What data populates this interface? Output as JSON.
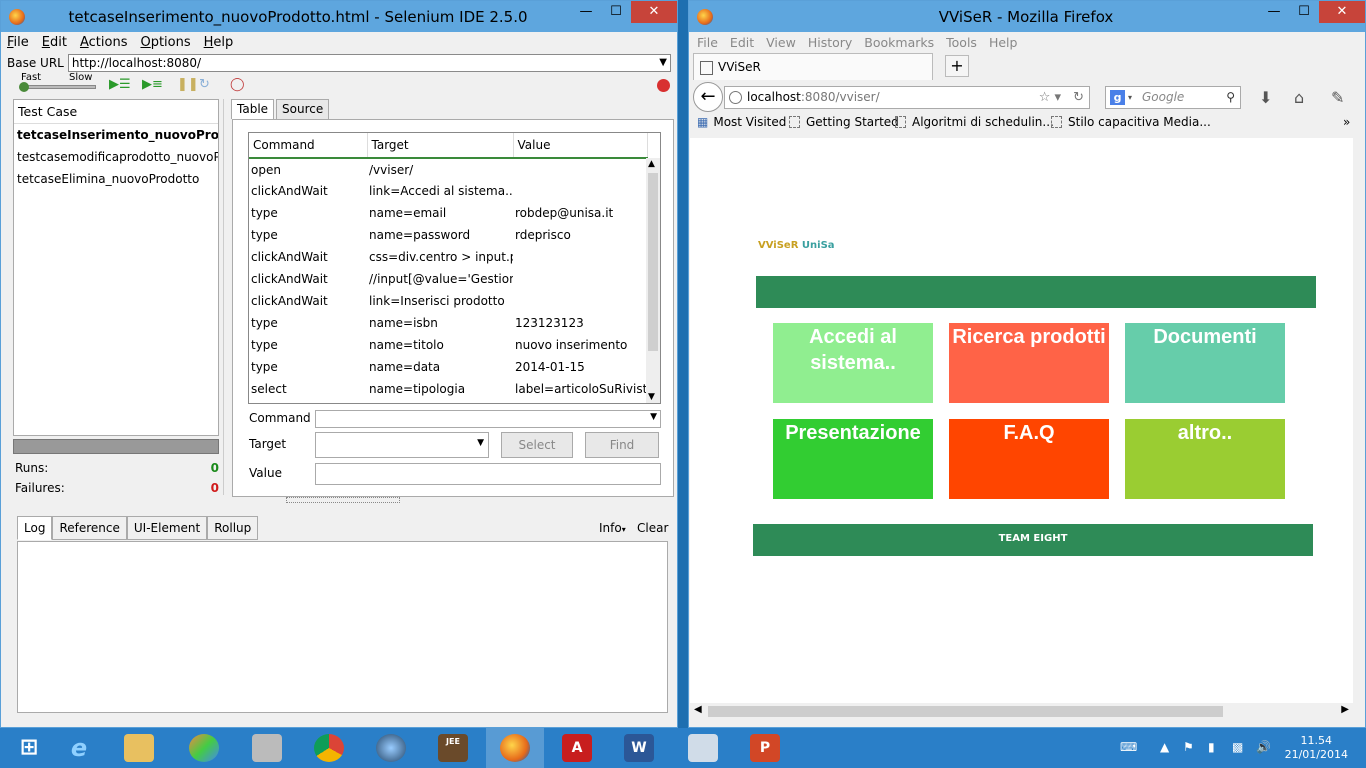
{
  "selenium": {
    "title": "tetcaseInserimento_nuovoProdotto.html - Selenium IDE 2.5.0",
    "menu": [
      "File",
      "Edit",
      "Actions",
      "Options",
      "Help"
    ],
    "base_url_label": "Base URL",
    "base_url_value": "http://localhost:8080/",
    "speed_fast": "Fast",
    "speed_slow": "Slow",
    "test_case_header": "Test Case",
    "test_cases": [
      "tetcaseInserimento_nuovoProdo...",
      "testcasemodificaprodotto_nuovoPr...",
      "tetcaseElimina_nuovoProdotto"
    ],
    "runs_label": "Runs:",
    "runs_value": "0",
    "failures_label": "Failures:",
    "failures_value": "0",
    "tabs": [
      "Table",
      "Source"
    ],
    "table_headers": [
      "Command",
      "Target",
      "Value"
    ],
    "commands": [
      {
        "command": "open",
        "target": "/vviser/",
        "value": ""
      },
      {
        "command": "clickAndWait",
        "target": "link=Accedi al sistema..",
        "value": ""
      },
      {
        "command": "type",
        "target": "name=email",
        "value": "robdep@unisa.it"
      },
      {
        "command": "type",
        "target": "name=password",
        "value": "rdeprisco"
      },
      {
        "command": "clickAndWait",
        "target": "css=div.centro > input.p...",
        "value": ""
      },
      {
        "command": "clickAndWait",
        "target": "//input[@value='Gestion...",
        "value": ""
      },
      {
        "command": "clickAndWait",
        "target": "link=Inserisci prodotto",
        "value": ""
      },
      {
        "command": "type",
        "target": "name=isbn",
        "value": "123123123"
      },
      {
        "command": "type",
        "target": "name=titolo",
        "value": "nuovo inserimento"
      },
      {
        "command": "type",
        "target": "name=data",
        "value": "2014-01-15"
      },
      {
        "command": "select",
        "target": "name=tipologia",
        "value": "label=articoloSuRivista"
      }
    ],
    "field_command_label": "Command",
    "field_target_label": "Target",
    "field_value_label": "Value",
    "select_button": "Select",
    "find_button": "Find",
    "log_tabs": [
      "Log",
      "Reference",
      "UI-Element",
      "Rollup"
    ],
    "info_label": "Info",
    "clear_label": "Clear"
  },
  "firefox": {
    "title": "VViSeR - Mozilla Firefox",
    "menu": [
      "File",
      "Edit",
      "View",
      "History",
      "Bookmarks",
      "Tools",
      "Help"
    ],
    "tab_title": "VViSeR",
    "url_host": "localhost",
    "url_rest": ":8080/vviser/",
    "search_placeholder": "Google",
    "bookmarks": [
      "Most Visited",
      "Getting Started",
      "Algoritmi di schedulin...",
      "Stilo capacitiva Media..."
    ],
    "page": {
      "logo_a": "VViSeR",
      "logo_b": " UniSa",
      "tiles": [
        {
          "label": "Accedi al sistema..",
          "color": "#90ee90"
        },
        {
          "label": "Ricerca prodotti",
          "color": "#ff6347"
        },
        {
          "label": "Documenti",
          "color": "#66cdaa"
        },
        {
          "label": "Presentazione",
          "color": "#32cd32"
        },
        {
          "label": "F.A.Q",
          "color": "#ff4500"
        },
        {
          "label": "altro..",
          "color": "#9acd32"
        }
      ],
      "footer": "TEAM EIGHT",
      "bar_color": "#2e8b57"
    }
  },
  "taskbar": {
    "time": "11.54",
    "date": "21/01/2014"
  }
}
